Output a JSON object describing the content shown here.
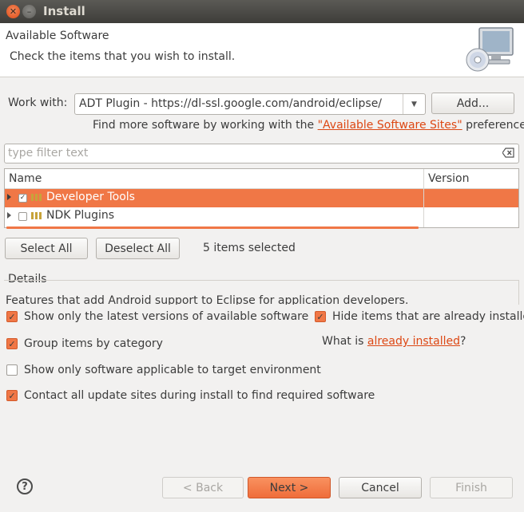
{
  "window": {
    "title": "Install",
    "close_glyph": "✕",
    "minimize_glyph": "–"
  },
  "header": {
    "title": "Available Software",
    "description": "Check the items that you wish to install.",
    "image_icon": "computer-cd-icon"
  },
  "work_with": {
    "label": "Work with:",
    "value": "ADT Plugin - https://dl-ssl.google.com/android/eclipse/",
    "add_button": "Add...",
    "find_more_prefix": "Find more software by working with the ",
    "find_more_link": "\"Available Software Sites\"",
    "find_more_suffix": " preferences."
  },
  "filter": {
    "placeholder": "type filter text"
  },
  "tree": {
    "columns": [
      "Name",
      "Version"
    ],
    "rows": [
      {
        "label": "Developer Tools",
        "checked": true,
        "selected": true,
        "version": ""
      },
      {
        "label": "NDK Plugins",
        "checked": false,
        "selected": false,
        "version": ""
      }
    ]
  },
  "selection": {
    "select_all": "Select All",
    "deselect_all": "Deselect All",
    "status": "5 items selected"
  },
  "details": {
    "label": "Details",
    "text": "Features that add Android support to Eclipse for application developers."
  },
  "options": {
    "latest_versions": {
      "label": "Show only the latest versions of available software",
      "checked": true
    },
    "hide_installed": {
      "label": "Hide items that are already installed",
      "checked": true
    },
    "group_by_category": {
      "label": "Group items by category",
      "checked": true
    },
    "what_is_prefix": "What is ",
    "what_is_link": "already installed",
    "what_is_suffix": "?",
    "applicable_only": {
      "label": "Show only software applicable to target environment",
      "checked": false
    },
    "contact_sites": {
      "label": "Contact all update sites during install to find required software",
      "checked": true
    }
  },
  "footer": {
    "help_glyph": "?",
    "back": "< Back",
    "next": "Next >",
    "cancel": "Cancel",
    "finish": "Finish"
  },
  "colors": {
    "accent": "#f07746",
    "link": "#dd4814",
    "titlebar": "#4a4945"
  }
}
